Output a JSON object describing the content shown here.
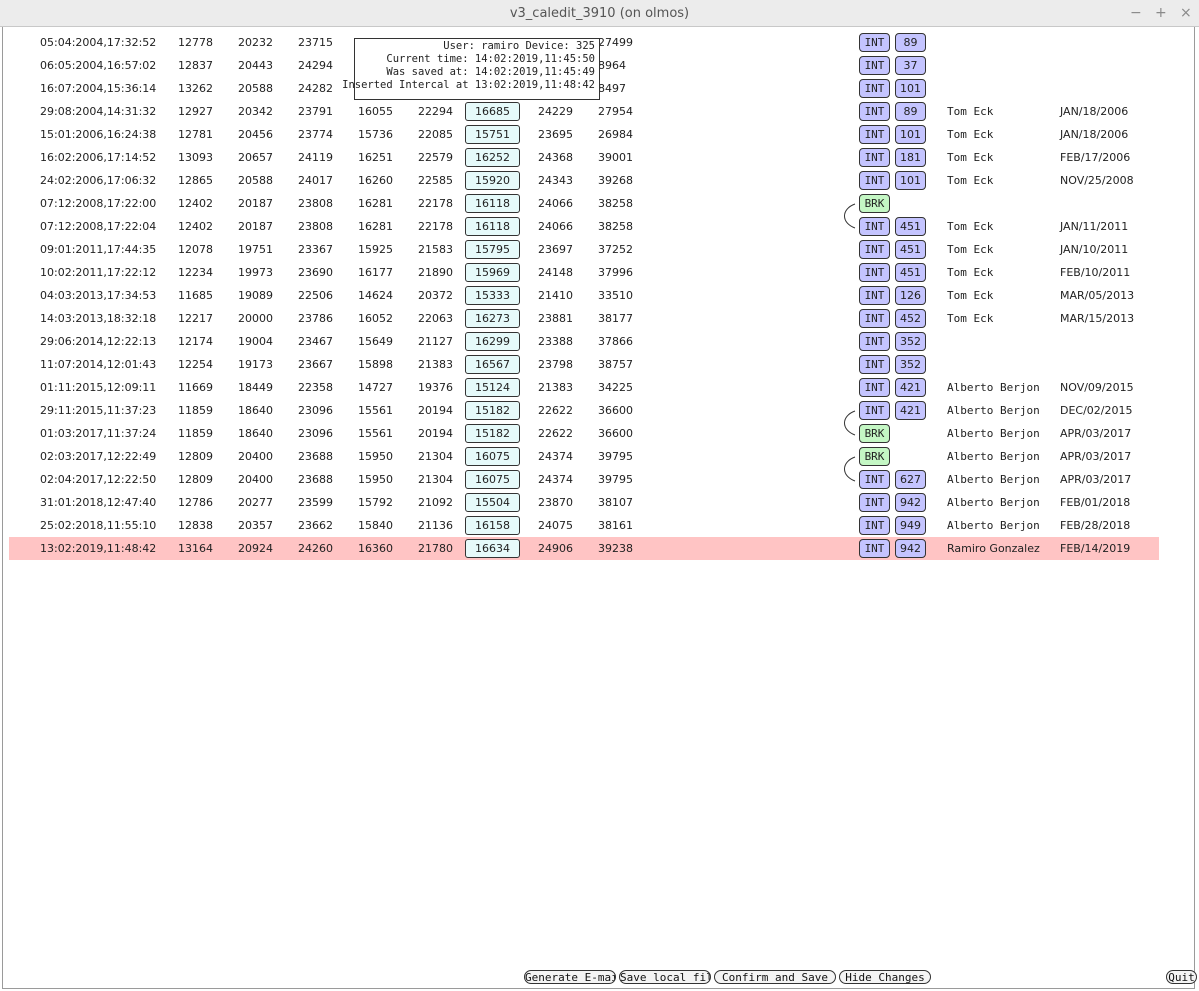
{
  "window": {
    "title": "v3_caledit_3910 (on olmos)",
    "controls": [
      "−",
      "+",
      "×"
    ]
  },
  "tooltip": {
    "line1": "User: ramiro Device: 325",
    "line2": "Current time: 14:02:2019,11:45:50",
    "line3": "Was saved at: 14:02:2019,11:45:49",
    "line4": "Inserted Intercal at 13:02:2019,11:48:42"
  },
  "rows": [
    {
      "time": "05:04:2004,17:32:52",
      "v1": "12778",
      "v2": "20232",
      "v3": "23715",
      "v4": "",
      "v5": "",
      "v6": "",
      "v7": "",
      "v8": "27499",
      "kind": "INT",
      "n": "89",
      "user": "",
      "date": ""
    },
    {
      "time": "06:05:2004,16:57:02",
      "v1": "12837",
      "v2": "20443",
      "v3": "24294",
      "v4": "",
      "v5": "",
      "v6": "",
      "v7": "",
      "v8": "8964",
      "kind": "INT",
      "n": "37",
      "user": "",
      "date": ""
    },
    {
      "time": "16:07:2004,15:36:14",
      "v1": "13262",
      "v2": "20588",
      "v3": "24282",
      "v4": "",
      "v5": "",
      "v6": "",
      "v7": "",
      "v8": "8497",
      "kind": "INT",
      "n": "101",
      "user": "",
      "date": ""
    },
    {
      "time": "29:08:2004,14:31:32",
      "v1": "12927",
      "v2": "20342",
      "v3": "23791",
      "v4": "16055",
      "v5": "22294",
      "v6": "16685",
      "v7": "24229",
      "v8": "27954",
      "kind": "INT",
      "n": "89",
      "user": "Tom Eck",
      "date": "JAN/18/2006"
    },
    {
      "time": "15:01:2006,16:24:38",
      "v1": "12781",
      "v2": "20456",
      "v3": "23774",
      "v4": "15736",
      "v5": "22085",
      "v6": "15751",
      "v7": "23695",
      "v8": "26984",
      "kind": "INT",
      "n": "101",
      "user": "Tom Eck",
      "date": "JAN/18/2006"
    },
    {
      "time": "16:02:2006,17:14:52",
      "v1": "13093",
      "v2": "20657",
      "v3": "24119",
      "v4": "16251",
      "v5": "22579",
      "v6": "16252",
      "v7": "24368",
      "v8": "39001",
      "kind": "INT",
      "n": "181",
      "user": "Tom Eck",
      "date": "FEB/17/2006"
    },
    {
      "time": "24:02:2006,17:06:32",
      "v1": "12865",
      "v2": "20588",
      "v3": "24017",
      "v4": "16260",
      "v5": "22585",
      "v6": "15920",
      "v7": "24343",
      "v8": "39268",
      "kind": "INT",
      "n": "101",
      "user": "Tom Eck",
      "date": "NOV/25/2008"
    },
    {
      "time": "07:12:2008,17:22:00",
      "v1": "12402",
      "v2": "20187",
      "v3": "23808",
      "v4": "16281",
      "v5": "22178",
      "v6": "16118",
      "v7": "24066",
      "v8": "38258",
      "kind": "BRK",
      "n": "",
      "user": "",
      "date": ""
    },
    {
      "time": "07:12:2008,17:22:04",
      "v1": "12402",
      "v2": "20187",
      "v3": "23808",
      "v4": "16281",
      "v5": "22178",
      "v6": "16118",
      "v7": "24066",
      "v8": "38258",
      "kind": "INT",
      "n": "451",
      "user": "Tom Eck",
      "date": "JAN/11/2011"
    },
    {
      "time": "09:01:2011,17:44:35",
      "v1": "12078",
      "v2": "19751",
      "v3": "23367",
      "v4": "15925",
      "v5": "21583",
      "v6": "15795",
      "v7": "23697",
      "v8": "37252",
      "kind": "INT",
      "n": "451",
      "user": "Tom Eck",
      "date": "JAN/10/2011"
    },
    {
      "time": "10:02:2011,17:22:12",
      "v1": "12234",
      "v2": "19973",
      "v3": "23690",
      "v4": "16177",
      "v5": "21890",
      "v6": "15969",
      "v7": "24148",
      "v8": "37996",
      "kind": "INT",
      "n": "451",
      "user": "Tom Eck",
      "date": "FEB/10/2011"
    },
    {
      "time": "04:03:2013,17:34:53",
      "v1": "11685",
      "v2": "19089",
      "v3": "22506",
      "v4": "14624",
      "v5": "20372",
      "v6": "15333",
      "v7": "21410",
      "v8": "33510",
      "kind": "INT",
      "n": "126",
      "user": "Tom Eck",
      "date": "MAR/05/2013"
    },
    {
      "time": "14:03:2013,18:32:18",
      "v1": "12217",
      "v2": "20000",
      "v3": "23786",
      "v4": "16052",
      "v5": "22063",
      "v6": "16273",
      "v7": "23881",
      "v8": "38177",
      "kind": "INT",
      "n": "452",
      "user": "Tom Eck",
      "date": "MAR/15/2013"
    },
    {
      "time": "29:06:2014,12:22:13",
      "v1": "12174",
      "v2": "19004",
      "v3": "23467",
      "v4": "15649",
      "v5": "21127",
      "v6": "16299",
      "v7": "23388",
      "v8": "37866",
      "kind": "INT",
      "n": "352",
      "user": "",
      "date": ""
    },
    {
      "time": "11:07:2014,12:01:43",
      "v1": "12254",
      "v2": "19173",
      "v3": "23667",
      "v4": "15898",
      "v5": "21383",
      "v6": "16567",
      "v7": "23798",
      "v8": "38757",
      "kind": "INT",
      "n": "352",
      "user": "",
      "date": ""
    },
    {
      "time": "01:11:2015,12:09:11",
      "v1": "11669",
      "v2": "18449",
      "v3": "22358",
      "v4": "14727",
      "v5": "19376",
      "v6": "15124",
      "v7": "21383",
      "v8": "34225",
      "kind": "INT",
      "n": "421",
      "user": "Alberto Berjon",
      "date": "NOV/09/2015"
    },
    {
      "time": "29:11:2015,11:37:23",
      "v1": "11859",
      "v2": "18640",
      "v3": "23096",
      "v4": "15561",
      "v5": "20194",
      "v6": "15182",
      "v7": "22622",
      "v8": "36600",
      "kind": "INT",
      "n": "421",
      "user": "Alberto Berjon",
      "date": "DEC/02/2015"
    },
    {
      "time": "01:03:2017,11:37:24",
      "v1": "11859",
      "v2": "18640",
      "v3": "23096",
      "v4": "15561",
      "v5": "20194",
      "v6": "15182",
      "v7": "22622",
      "v8": "36600",
      "kind": "BRK",
      "n": "",
      "user": "Alberto Berjon",
      "date": "APR/03/2017"
    },
    {
      "time": "02:03:2017,12:22:49",
      "v1": "12809",
      "v2": "20400",
      "v3": "23688",
      "v4": "15950",
      "v5": "21304",
      "v6": "16075",
      "v7": "24374",
      "v8": "39795",
      "kind": "BRK",
      "n": "",
      "user": "Alberto Berjon",
      "date": "APR/03/2017"
    },
    {
      "time": "02:04:2017,12:22:50",
      "v1": "12809",
      "v2": "20400",
      "v3": "23688",
      "v4": "15950",
      "v5": "21304",
      "v6": "16075",
      "v7": "24374",
      "v8": "39795",
      "kind": "INT",
      "n": "627",
      "user": "Alberto Berjon",
      "date": "APR/03/2017"
    },
    {
      "time": "31:01:2018,12:47:40",
      "v1": "12786",
      "v2": "20277",
      "v3": "23599",
      "v4": "15792",
      "v5": "21092",
      "v6": "15504",
      "v7": "23870",
      "v8": "38107",
      "kind": "INT",
      "n": "942",
      "user": "Alberto Berjon",
      "date": "FEB/01/2018"
    },
    {
      "time": "25:02:2018,11:55:10",
      "v1": "12838",
      "v2": "20357",
      "v3": "23662",
      "v4": "15840",
      "v5": "21136",
      "v6": "16158",
      "v7": "24075",
      "v8": "38161",
      "kind": "INT",
      "n": "949",
      "user": "Alberto Berjon",
      "date": "FEB/28/2018"
    },
    {
      "time": "13:02:2019,11:48:42",
      "v1": "13164",
      "v2": "20924",
      "v3": "24260",
      "v4": "16360",
      "v5": "21780",
      "v6": "16634",
      "v7": "24906",
      "v8": "39238",
      "kind": "INT",
      "n": "942",
      "user": "Ramiro Gonzalez",
      "date": "FEB/14/2019",
      "highlight": true
    }
  ],
  "buttons": {
    "email": "Generate E-mail",
    "local": "Save local file",
    "confirm": "Confirm and Save",
    "hide": "Hide Changes",
    "quit": "Quit"
  },
  "colors": {
    "int_tag": "#c4c4ff",
    "brk_tag": "#c4f7c4",
    "value_box": "#e6fafa",
    "highlight_row": "#ffc4c4"
  }
}
